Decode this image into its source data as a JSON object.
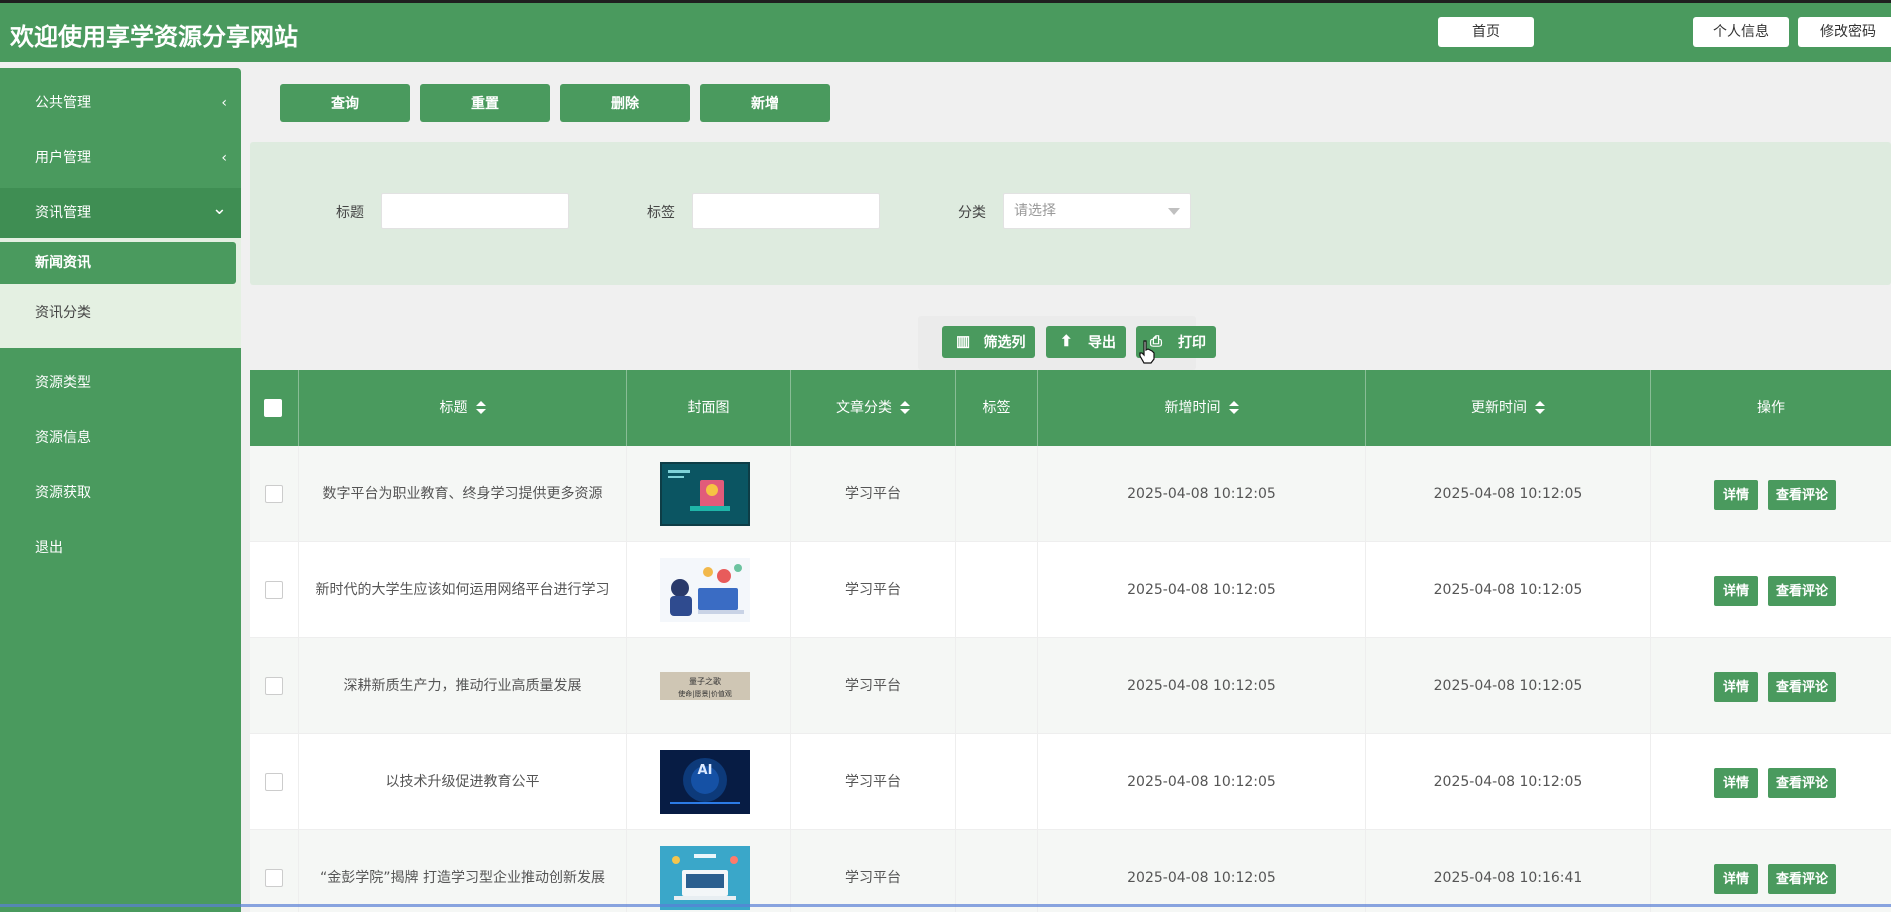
{
  "header": {
    "title": "欢迎使用享学资源分享网站",
    "home": "首页",
    "profile": "个人信息",
    "change_password": "修改密码"
  },
  "sidebar": {
    "items": [
      {
        "label": "公共管理",
        "chevron": "‹"
      },
      {
        "label": "用户管理",
        "chevron": "‹"
      },
      {
        "label": "资讯管理",
        "chevron": "⌄"
      },
      {
        "label": "资源类型"
      },
      {
        "label": "资源信息"
      },
      {
        "label": "资源获取"
      },
      {
        "label": "退出"
      }
    ],
    "subitems": [
      {
        "label": "新闻资讯"
      },
      {
        "label": "资讯分类"
      }
    ]
  },
  "toolbar": {
    "query": "查询",
    "reset": "重置",
    "delete": "删除",
    "add": "新增"
  },
  "search": {
    "title_label": "标题",
    "tag_label": "标签",
    "category_label": "分类",
    "category_placeholder": "请选择"
  },
  "table_actions": {
    "filter_columns": "筛选列",
    "export": "导出",
    "print": "打印"
  },
  "table": {
    "columns": [
      "标题",
      "封面图",
      "文章分类",
      "标签",
      "新增时间",
      "更新时间",
      "操作"
    ],
    "rows": [
      {
        "title": "数字平台为职业教育、终身学习提供更多资源",
        "category": "学习平台",
        "tag": "",
        "created": "2025-04-08 10:12:05",
        "updated": "2025-04-08 10:12:05"
      },
      {
        "title": "新时代的大学生应该如何运用网络平台进行学习",
        "category": "学习平台",
        "tag": "",
        "created": "2025-04-08 10:12:05",
        "updated": "2025-04-08 10:12:05"
      },
      {
        "title": "深耕新质生产力，推动行业高质量发展",
        "category": "学习平台",
        "tag": "",
        "created": "2025-04-08 10:12:05",
        "updated": "2025-04-08 10:12:05"
      },
      {
        "title": "以技术升级促进教育公平",
        "category": "学习平台",
        "tag": "",
        "created": "2025-04-08 10:12:05",
        "updated": "2025-04-08 10:12:05"
      },
      {
        "title": "“金彭学院”揭牌 打造学习型企业推动创新发展",
        "category": "学习平台",
        "tag": "",
        "created": "2025-04-08 10:12:05",
        "updated": "2025-04-08 10:16:41"
      }
    ],
    "row_actions": {
      "detail": "详情",
      "comments": "查看评论"
    }
  },
  "thumbnails": {
    "row3_line1": "量子之歌",
    "row3_line2": "使命|愿景|价值观",
    "row4_text": "AI"
  },
  "colors": {
    "primary": "#4a9a5e",
    "panel": "#deebdf",
    "submenu": "#e4f0e2"
  }
}
